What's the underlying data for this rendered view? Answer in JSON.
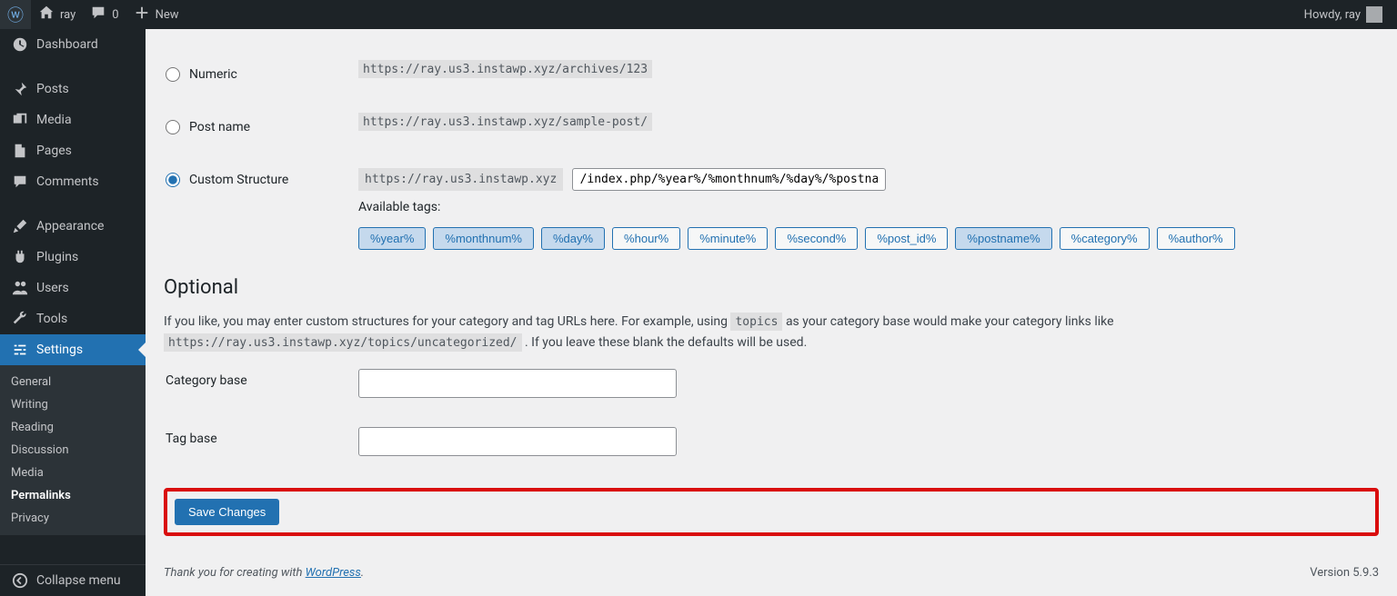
{
  "topbar": {
    "site_name": "ray",
    "comment_count": "0",
    "new_label": "New",
    "howdy": "Howdy, ray"
  },
  "sidebar": {
    "dashboard": "Dashboard",
    "posts": "Posts",
    "media": "Media",
    "pages": "Pages",
    "comments": "Comments",
    "appearance": "Appearance",
    "plugins": "Plugins",
    "users": "Users",
    "tools": "Tools",
    "settings": "Settings",
    "subitems": {
      "general": "General",
      "writing": "Writing",
      "reading": "Reading",
      "discussion": "Discussion",
      "media": "Media",
      "permalinks": "Permalinks",
      "privacy": "Privacy"
    },
    "collapse": "Collapse menu"
  },
  "permalinks": {
    "numeric_label": "Numeric",
    "numeric_url": "https://ray.us3.instawp.xyz/archives/123",
    "postname_label": "Post name",
    "postname_url": "https://ray.us3.instawp.xyz/sample-post/",
    "custom_label": "Custom Structure",
    "custom_prefix": "https://ray.us3.instawp.xyz",
    "custom_value": "/index.php/%year%/%monthnum%/%day%/%postname%/",
    "available_tags_label": "Available tags:",
    "tags": [
      "%year%",
      "%monthnum%",
      "%day%",
      "%hour%",
      "%minute%",
      "%second%",
      "%post_id%",
      "%postname%",
      "%category%",
      "%author%"
    ]
  },
  "optional": {
    "heading": "Optional",
    "desc_pre": "If you like, you may enter custom structures for your category and tag URLs here. For example, using ",
    "desc_code1": "topics",
    "desc_mid": " as your category base would make your category links like ",
    "desc_code2": "https://ray.us3.instawp.xyz/topics/uncategorized/",
    "desc_post": " . If you leave these blank the defaults will be used.",
    "category_base_label": "Category base",
    "tag_base_label": "Tag base"
  },
  "save_label": "Save Changes",
  "footer": {
    "thanks_pre": "Thank you for creating with ",
    "wp": "WordPress",
    "version": "Version 5.9.3"
  }
}
